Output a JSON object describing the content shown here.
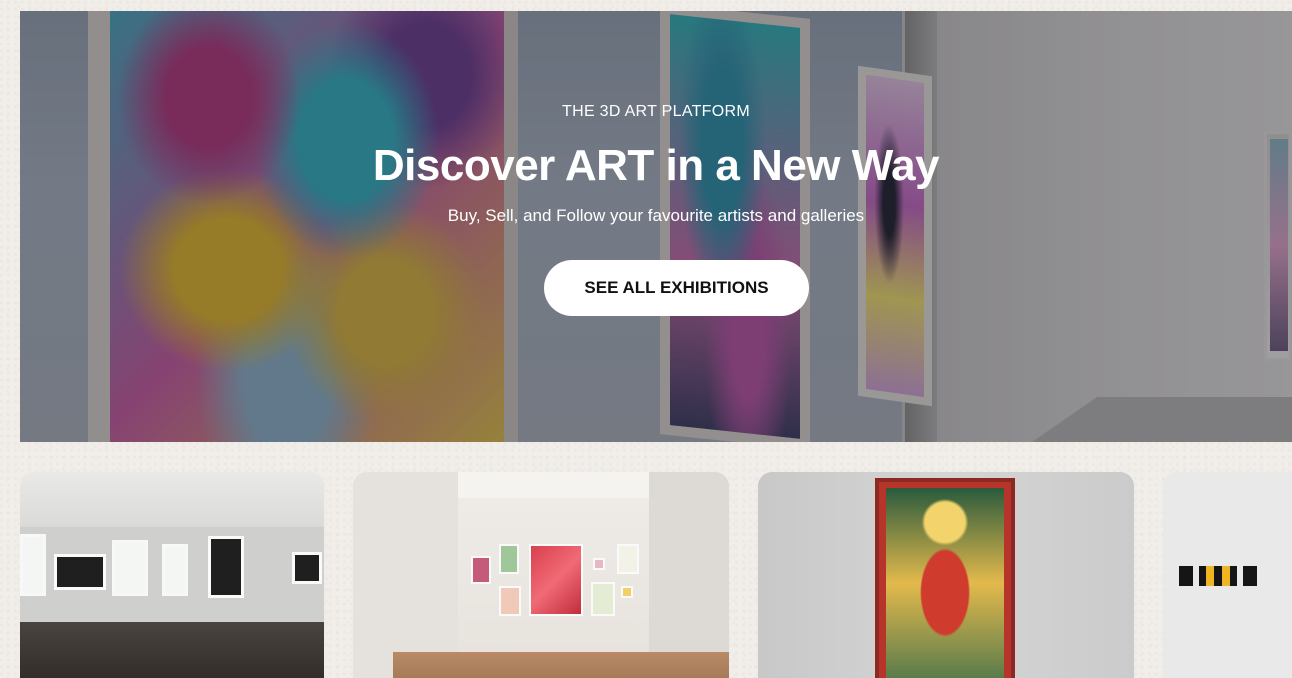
{
  "hero": {
    "eyebrow": "THE 3D ART PLATFORM",
    "headline": "Discover ART in a New Way",
    "subline": "Buy, Sell, and Follow your favourite artists and galleries",
    "cta_label": "SEE ALL EXHIBITIONS"
  },
  "cards": [
    {
      "name": "exhibition-card-1",
      "scene": "gallery with black and white photographs"
    },
    {
      "name": "exhibition-card-2",
      "scene": "white room with colorful paintings"
    },
    {
      "name": "exhibition-card-3",
      "scene": "religious icon painting"
    },
    {
      "name": "exhibition-card-4",
      "scene": "gallery with small dark artworks"
    }
  ],
  "colors": {
    "page_background": "#f1eeea",
    "cta_background": "#ffffff",
    "cta_text": "#111111",
    "hero_text": "#ffffff"
  }
}
